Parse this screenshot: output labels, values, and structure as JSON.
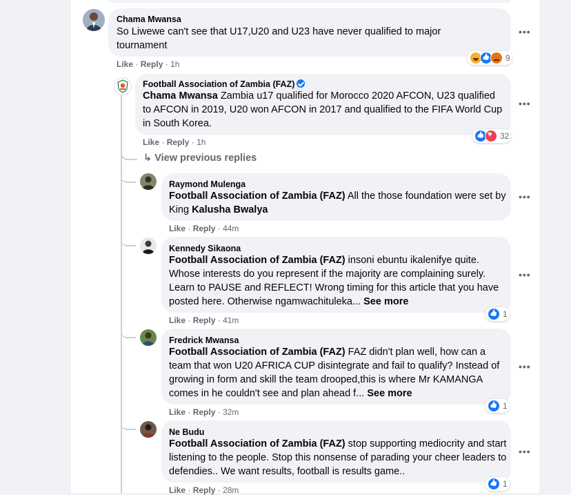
{
  "comments": [
    {
      "author": "Chama Mwansa",
      "text": "So Liwewe can't see that U17,U20 and U23 have never qualified to major tournament",
      "like": "Like",
      "reply": "Reply",
      "time": "1h",
      "reaction_count": "9",
      "reactions": [
        "haha-icon",
        "like-icon",
        "angry-icon"
      ]
    },
    {
      "author": "Football Association of Zambia (FAZ)",
      "verified": true,
      "mention": "Chama Mwansa",
      "text": "Zambia u17 qualified for Morocco 2020 AFCON, U23 qualified to AFCON in 2019, U20 won AFCON in 2017 and qualified to the FIFA World Cup in South Korea.",
      "like": "Like",
      "reply": "Reply",
      "time": "1h",
      "reaction_count": "32",
      "reactions": [
        "like-icon",
        "heart-icon"
      ]
    }
  ],
  "view_previous_replies": "View previous replies",
  "replies": [
    {
      "author": "Raymond Mulenga",
      "mention": "Football Association of Zambia (FAZ)",
      "text_a": "All the those foundation were set by King",
      "mention_b": "Kalusha Bwalya",
      "like": "Like",
      "reply": "Reply",
      "time": "44m"
    },
    {
      "author": "Kennedy Sikaona",
      "mention": "Football Association of Zambia (FAZ)",
      "text": "insoni ebuntu ikalenifye quite. Whose interests do you represent if the majority are complaining surely. Learn to PAUSE and REFLECT! Wrong timing for this article that you have posted here. Otherwise ngamwachituleka...",
      "see_more": "See more",
      "like": "Like",
      "reply": "Reply",
      "time": "41m",
      "reaction_count": "1"
    },
    {
      "author": "Fredrick Mwansa",
      "mention": "Football Association of Zambia (FAZ)",
      "text": "FAZ didn't plan well, how can a team that won U20 AFRICA CUP disintegrate and fail to qualify? Instead of growing in form and skill the team drooped,this is where Mr KAMANGA comes in he couldn't see and plan ahead f...",
      "see_more": "See more",
      "like": "Like",
      "reply": "Reply",
      "time": "32m",
      "reaction_count": "1"
    },
    {
      "author": "Ne Budu",
      "mention": "Football Association of Zambia (FAZ)",
      "text": "stop supporting mediocrity and start listening to the people. Stop this nonsense of parading your cheer leaders to defendies.. We want results, football is results game..",
      "like": "Like",
      "reply": "Reply",
      "time": "28m",
      "reaction_count": "1"
    }
  ],
  "separator": "·",
  "more_icon": "•••",
  "reply_arrow_icon": "↳",
  "colors": {
    "bubble": "#f0f2f5",
    "secondary_text": "#65676b",
    "like_blue": "#1877f2",
    "heart_red": "#f33e58"
  }
}
